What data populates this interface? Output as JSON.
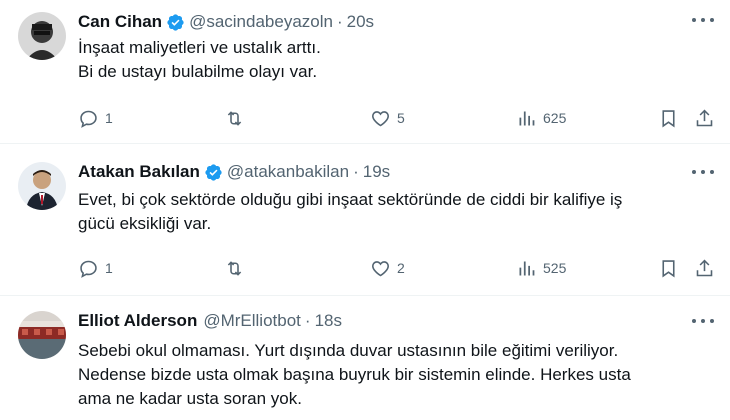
{
  "tweets": [
    {
      "name": "Can Cihan",
      "handle": "@sacindabeyazoln",
      "separator": "·",
      "time": "20s",
      "text": "İnşaat maliyetleri ve ustalık arttı.\nBi de ustayı bulabilme olayı var.",
      "replies": "1",
      "retweets": "",
      "likes": "5",
      "views": "625"
    },
    {
      "name": "Atakan Bakılan",
      "handle": "@atakanbakilan",
      "separator": "·",
      "time": "19s",
      "text": "Evet, bi çok sektörde olduğu gibi inşaat sektöründe de ciddi bir kalifiye iş\ngücü eksikliği var.",
      "replies": "1",
      "retweets": "",
      "likes": "2",
      "views": "525"
    },
    {
      "name": "Elliot Alderson",
      "handle": "@MrElliotbot",
      "separator": "·",
      "time": "18s",
      "text": "Sebebi okul olmaması. Yurt dışında duvar ustasının bile eğitimi veriliyor.\nNedense bizde usta olmak başına buyruk bir sistemin elinde. Herkes usta\nama ne kadar usta soran yok."
    }
  ],
  "icons": {
    "verified": "verified-badge-icon",
    "reply": "reply-icon",
    "retweet": "retweet-icon",
    "like": "heart-icon",
    "views": "views-bar-chart-icon",
    "bookmark": "bookmark-icon",
    "share": "share-icon",
    "more": "more-dots-icon"
  },
  "colors": {
    "text": "#0f1419",
    "secondary": "#536471",
    "verified": "#1d9bf0",
    "divider": "#eff3f4"
  }
}
